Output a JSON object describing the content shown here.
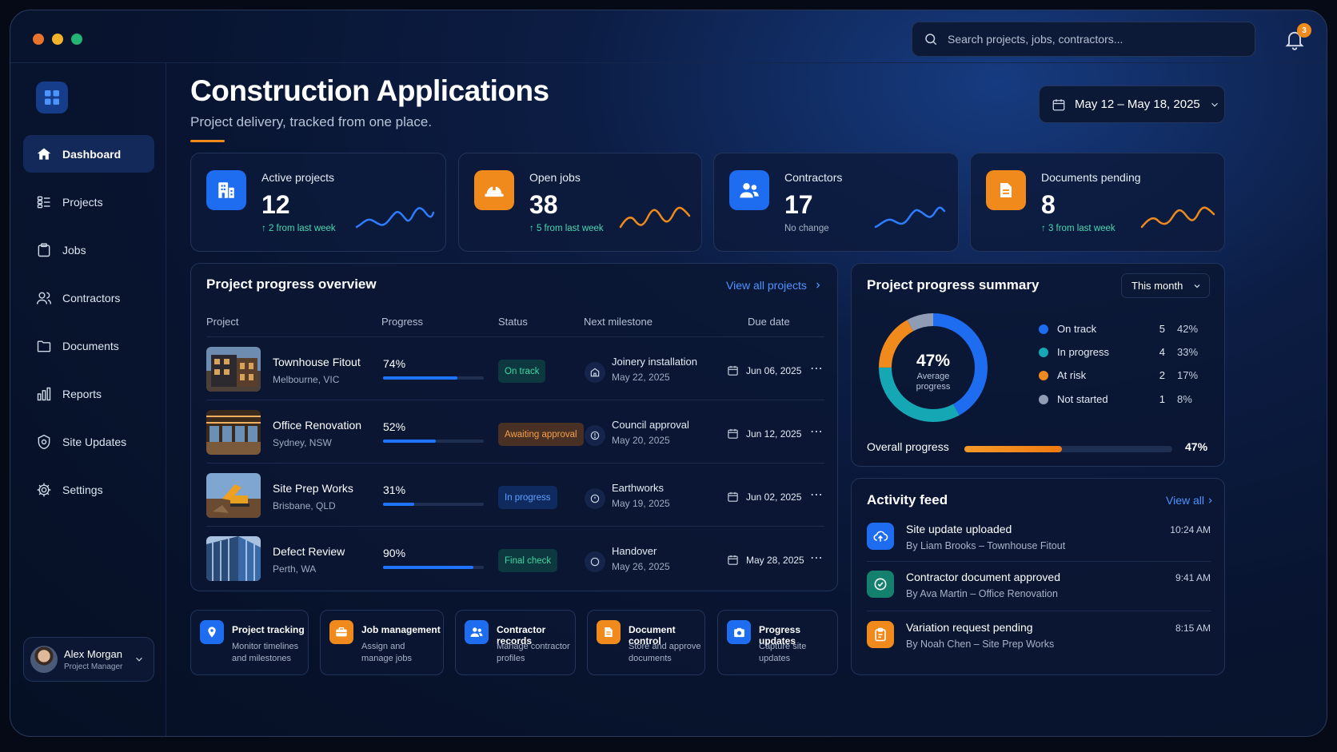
{
  "window": {
    "traffic_lights": [
      "#e8732a",
      "#f2b22a",
      "#22b573"
    ]
  },
  "header": {
    "search_placeholder": "Search projects, jobs, contractors...",
    "notifications_count": "3"
  },
  "sidebar": {
    "items": [
      {
        "label": "Dashboard",
        "icon": "home-icon",
        "active": true
      },
      {
        "label": "Projects",
        "icon": "list-icon"
      },
      {
        "label": "Jobs",
        "icon": "clipboard-icon"
      },
      {
        "label": "Contractors",
        "icon": "users-icon"
      },
      {
        "label": "Documents",
        "icon": "folder-icon"
      },
      {
        "label": "Reports",
        "icon": "bar-chart-icon"
      },
      {
        "label": "Site Updates",
        "icon": "shield-icon"
      },
      {
        "label": "Settings",
        "icon": "gear-icon"
      }
    ],
    "user": {
      "name": "Alex Morgan",
      "role": "Project Manager"
    }
  },
  "page": {
    "title": "Construction Applications",
    "subtitle": "Project delivery, tracked from one place.",
    "date_range": "May 12 – May 18, 2025"
  },
  "stats": [
    {
      "label": "Active projects",
      "value": "12",
      "change": "↑ 2 from last week",
      "icon": "building-icon",
      "color": "#1e6cf0"
    },
    {
      "label": "Open jobs",
      "value": "38",
      "change": "↑ 5 from last week",
      "icon": "hard-hat-icon",
      "color": "#f08a1c"
    },
    {
      "label": "Contractors",
      "value": "17",
      "change": "No change",
      "icon": "users-icon",
      "color": "#1e6cf0"
    },
    {
      "label": "Documents pending",
      "value": "8",
      "change": "↑ 3 from last week",
      "icon": "document-icon",
      "color": "#f08a1c"
    }
  ],
  "overview": {
    "title": "Project progress overview",
    "view_all": "View all projects",
    "columns": [
      "Project",
      "Progress",
      "Status",
      "Next milestone",
      "Due date"
    ],
    "rows": [
      {
        "name": "Townhouse Fitout",
        "location": "Melbourne, VIC",
        "progress": "74%",
        "progress_value": 0.74,
        "status": "On track",
        "status_kind": "green",
        "milestone": "Joinery installation",
        "milestone_date": "May 22, 2025",
        "due": "Jun 06, 2025"
      },
      {
        "name": "Office Renovation",
        "location": "Sydney, NSW",
        "progress": "52%",
        "progress_value": 0.52,
        "status": "Awaiting approval",
        "status_kind": "orange",
        "milestone": "Council approval",
        "milestone_date": "May 20, 2025",
        "due": "Jun 12, 2025"
      },
      {
        "name": "Site Prep Works",
        "location": "Brisbane, QLD",
        "progress": "31%",
        "progress_value": 0.31,
        "status": "In progress",
        "status_kind": "blue",
        "milestone": "Earthworks",
        "milestone_date": "May 19, 2025",
        "due": "Jun 02, 2025"
      },
      {
        "name": "Defect Review",
        "location": "Perth, WA",
        "progress": "90%",
        "progress_value": 0.9,
        "status": "Final check",
        "status_kind": "green",
        "milestone": "Handover",
        "milestone_date": "May 26, 2025",
        "due": "May 28, 2025"
      }
    ]
  },
  "summary": {
    "title": "Project progress summary",
    "period": "This month",
    "center_value": "47%",
    "center_label": "Average progress",
    "legend": [
      {
        "label": "On track",
        "count": "5",
        "pct": "42%",
        "share": 0.42,
        "color": "#1e6cf0"
      },
      {
        "label": "In progress",
        "count": "4",
        "pct": "33%",
        "share": 0.33,
        "color": "#16a7b5"
      },
      {
        "label": "At risk",
        "count": "2",
        "pct": "17%",
        "share": 0.17,
        "color": "#f08a1c"
      },
      {
        "label": "Not started",
        "count": "1",
        "pct": "8%",
        "share": 0.08,
        "color": "#8f9cb3"
      }
    ],
    "overall_label": "Overall progress",
    "overall_pct": "47%",
    "overall_value": 0.47
  },
  "activity": {
    "title": "Activity feed",
    "view_all": "View all",
    "items": [
      {
        "title": "Site update uploaded",
        "sub": "By Liam Brooks – Townhouse Fitout",
        "time": "10:24 AM",
        "icon": "cloud-upload-icon",
        "color": "#1e6cf0"
      },
      {
        "title": "Contractor document approved",
        "sub": "By Ava Martin – Office Renovation",
        "time": "9:41 AM",
        "icon": "check-circle-icon",
        "color": "#14806e"
      },
      {
        "title": "Variation request pending",
        "sub": "By Noah Chen – Site Prep Works",
        "time": "8:15 AM",
        "icon": "clipboard-edit-icon",
        "color": "#f08a1c"
      }
    ]
  },
  "quick_links": [
    {
      "title": "Project tracking",
      "desc1": "Monitor timelines",
      "desc2": "and milestones",
      "icon": "location-pin-icon",
      "color": "#1e6cf0"
    },
    {
      "title": "Job management",
      "desc1": "Assign and",
      "desc2": "manage jobs",
      "icon": "briefcase-icon",
      "color": "#f08a1c"
    },
    {
      "title": "Contractor records",
      "desc1": "Manage contractor",
      "desc2": "profiles",
      "icon": "users-icon",
      "color": "#1e6cf0"
    },
    {
      "title": "Document control",
      "desc1": "Store and approve",
      "desc2": "documents",
      "icon": "document-icon",
      "color": "#f08a1c"
    },
    {
      "title": "Progress updates",
      "desc1": "Capture site",
      "desc2": "updates",
      "icon": "camera-icon",
      "color": "#1e6cf0"
    }
  ]
}
